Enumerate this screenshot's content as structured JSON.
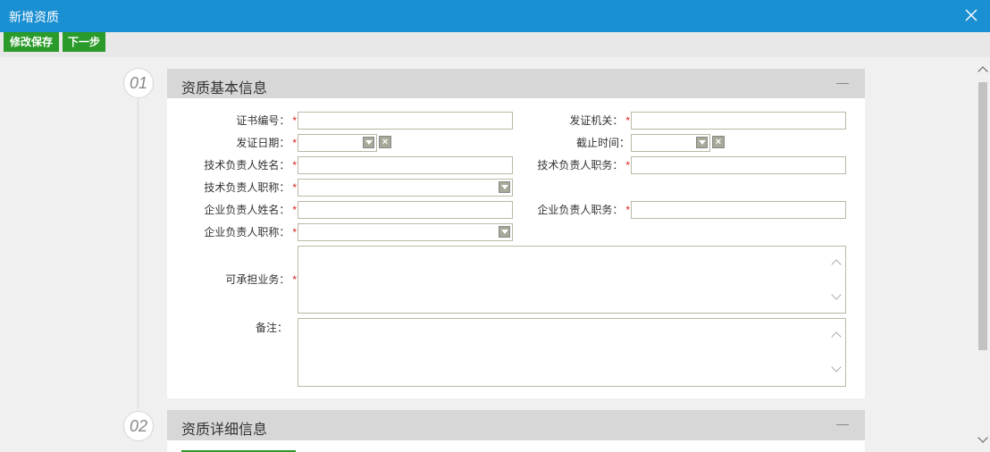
{
  "window": {
    "title": "新增资质"
  },
  "toolbar": {
    "save_label": "修改保存",
    "next_label": "下一步"
  },
  "steps": [
    {
      "num": "01",
      "title": "资质基本信息"
    },
    {
      "num": "02",
      "title": "资质详细信息"
    }
  ],
  "fields": {
    "cert_no": {
      "label": "证书编号：",
      "value": ""
    },
    "issuer": {
      "label": "发证机关：",
      "value": ""
    },
    "issue_date": {
      "label": "发证日期：",
      "value": ""
    },
    "expire_time": {
      "label": "截止时间：",
      "value": ""
    },
    "tech_name": {
      "label": "技术负责人姓名：",
      "value": ""
    },
    "tech_post": {
      "label": "技术负责人职务：",
      "value": ""
    },
    "tech_title": {
      "label": "技术负责人职称：",
      "value": ""
    },
    "ent_name": {
      "label": "企业负责人姓名：",
      "value": ""
    },
    "ent_post": {
      "label": "企业负责人职务：",
      "value": ""
    },
    "ent_title": {
      "label": "企业负责人职称：",
      "value": ""
    },
    "business": {
      "label": "可承担业务：",
      "value": ""
    },
    "remark": {
      "label": "备注：",
      "value": ""
    }
  },
  "required_mark": "*",
  "clear_glyph": "×",
  "colors": {
    "titlebar": "#1a8fd1",
    "button": "#2a9a2a",
    "required": "#e02020"
  }
}
